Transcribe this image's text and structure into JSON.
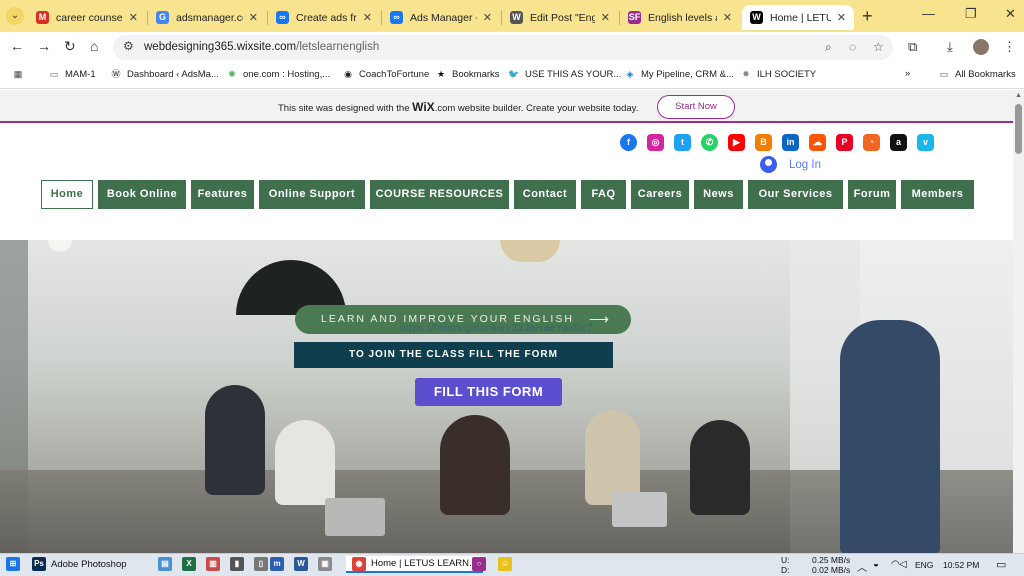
{
  "browser": {
    "tabs": [
      {
        "title": "career counsellir",
        "favicon": "M",
        "color": "#d93025"
      },
      {
        "title": "adsmanager.con",
        "favicon": "G",
        "color": "#4285f4"
      },
      {
        "title": "Create ads from",
        "favicon": "∞",
        "color": "#1877f2"
      },
      {
        "title": "Ads Manager - M",
        "favicon": "∞",
        "color": "#1877f2"
      },
      {
        "title": "Edit Post \"Englis",
        "favicon": "W",
        "color": "#555555"
      },
      {
        "title": "English levels an",
        "favicon": "SF",
        "color": "#9b2c8f"
      },
      {
        "title": "Home | LETUS LE",
        "favicon": "W",
        "color": "#000000",
        "active": true
      }
    ],
    "url_host": "webdesigning365.wixsite.com",
    "url_path": "/letslearnenglish",
    "bookmarks": [
      {
        "label": "MAM-1",
        "icon": "folder-icon"
      },
      {
        "label": "Dashboard ‹ AdsMa...",
        "icon": "wordpress-icon"
      },
      {
        "label": "one.com : Hosting,...",
        "icon": "onecom-icon"
      },
      {
        "label": "CoachToFortune",
        "icon": "globe-icon"
      },
      {
        "label": "Bookmarks",
        "icon": "star-icon"
      },
      {
        "label": "USE THIS AS YOUR...",
        "icon": "bird-icon"
      },
      {
        "label": "My Pipeline, CRM &...",
        "icon": "pipeline-icon"
      },
      {
        "label": "ILH SOCIETY",
        "icon": "ilh-icon"
      }
    ],
    "all_bookmarks": "All Bookmarks"
  },
  "wix_banner": {
    "text_before": "This site was designed with the",
    "brand": "WiX",
    "text_after": ".com website builder. Create your website today.",
    "cta": "Start Now"
  },
  "social_icons": [
    {
      "name": "facebook-icon",
      "glyph": "f",
      "color": "#1877f2"
    },
    {
      "name": "instagram-icon",
      "glyph": "◎",
      "color": "#d6249f"
    },
    {
      "name": "twitter-icon",
      "glyph": "t",
      "color": "#1da1f2"
    },
    {
      "name": "whatsapp-icon",
      "glyph": "✆",
      "color": "#25d366"
    },
    {
      "name": "youtube-icon",
      "glyph": "▶",
      "color": "#ff0000"
    },
    {
      "name": "blogger-icon",
      "glyph": "B",
      "color": "#f57d00"
    },
    {
      "name": "linkedin-icon",
      "glyph": "in",
      "color": "#0a66c2"
    },
    {
      "name": "soundcloud-icon",
      "glyph": "☁",
      "color": "#ff5500"
    },
    {
      "name": "pinterest-icon",
      "glyph": "P",
      "color": "#e60023"
    },
    {
      "name": "rss-icon",
      "glyph": "◔",
      "color": "#f26522"
    },
    {
      "name": "amazon-icon",
      "glyph": "a",
      "color": "#111111"
    },
    {
      "name": "vimeo-icon",
      "glyph": "v",
      "color": "#1ab7ea"
    }
  ],
  "login": "Log In",
  "nav": [
    "Home",
    "Book Online",
    "Features",
    "Online Support",
    "COURSE RESOURCES",
    "Contact",
    "FAQ",
    "Careers",
    "News",
    "Our Services",
    "Forum",
    "Members"
  ],
  "hero": {
    "pill": "LEARN AND IMPROVE YOUR ENGLISH",
    "pill_url": "https://forms.gle/mkwYZkJaHaeYaxDc7",
    "join": "TO JOIN THE CLASS FILL THE FORM",
    "button": "FILL THIS FORM"
  },
  "taskbar": {
    "photoshop": "Adobe Photoshop",
    "chrome": "Home | LETUS LEARN...",
    "upload": "0.25 MB/s",
    "download": "0.02 MB/s",
    "up_label": "U:",
    "down_label": "D:",
    "lang": "ENG",
    "time": "10:52 PM"
  },
  "colors": {
    "nav_green": "#3f6f4d",
    "wix_purple": "#9b2c8f",
    "join_teal": "#0f3e4f",
    "form_button": "#5b4fcf"
  }
}
